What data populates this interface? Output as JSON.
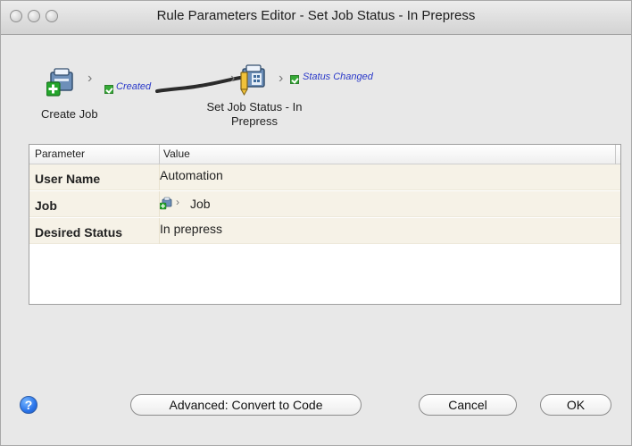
{
  "window": {
    "title": "Rule Parameters Editor - Set Job Status - In Prepress"
  },
  "flow": {
    "node1": {
      "label": "Create Job",
      "event": "Created",
      "icon": "create-job-icon"
    },
    "node2": {
      "label_line1": "Set Job Status - In",
      "label_line2": "Prepress",
      "event": "Status Changed",
      "icon": "set-job-status-icon"
    }
  },
  "table": {
    "columns": [
      "Parameter",
      "Value"
    ],
    "rows": [
      {
        "name": "User Name",
        "value": "Automation"
      },
      {
        "name": "Job",
        "value": "Job",
        "icon": "job-icon"
      },
      {
        "name": "Desired Status",
        "value": "In prepress"
      }
    ]
  },
  "buttons": {
    "help": "?",
    "advanced": "Advanced: Convert to Code",
    "cancel": "Cancel",
    "ok": "OK"
  },
  "colors": {
    "event_label": "#2a39c9",
    "row_background": "#f6f2e7",
    "checkbox_green": "#35a936"
  }
}
